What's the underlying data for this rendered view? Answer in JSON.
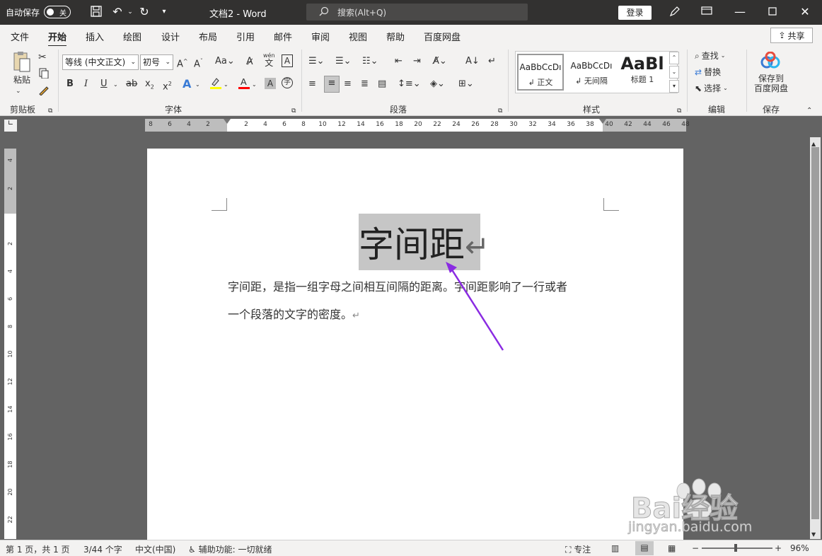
{
  "titlebar": {
    "autosave_label": "自动保存",
    "autosave_state": "关",
    "document_title": "文档2  -  Word",
    "search_placeholder": "搜索(Alt+Q)",
    "login_label": "登录"
  },
  "menu": {
    "tabs": [
      "文件",
      "开始",
      "插入",
      "绘图",
      "设计",
      "布局",
      "引用",
      "邮件",
      "审阅",
      "视图",
      "帮助",
      "百度网盘"
    ],
    "active_tab": "开始",
    "share_label": "共享"
  },
  "ribbon": {
    "clipboard": {
      "paste_label": "粘贴",
      "group_label": "剪贴板"
    },
    "font": {
      "font_name": "等线 (中文正文)",
      "font_size": "初号",
      "group_label": "字体"
    },
    "paragraph": {
      "group_label": "段落"
    },
    "styles": {
      "items": [
        {
          "preview": "AaBbCcDı",
          "name": "↲ 正文"
        },
        {
          "preview": "AaBbCcDı",
          "name": "↲ 无间隔"
        },
        {
          "preview": "AaBl",
          "name": "标题 1"
        }
      ],
      "group_label": "样式"
    },
    "editing": {
      "find_label": "查找",
      "replace_label": "替换",
      "select_label": "选择",
      "group_label": "编辑"
    },
    "save": {
      "save_to_baidu_line1": "保存到",
      "save_to_baidu_line2": "百度网盘",
      "group_label": "保存"
    }
  },
  "ruler": {
    "h_ticks": [
      "8",
      "6",
      "4",
      "2",
      "2",
      "4",
      "6",
      "8",
      "10",
      "12",
      "14",
      "16",
      "18",
      "20",
      "22",
      "24",
      "26",
      "28",
      "30",
      "32",
      "34",
      "36",
      "38",
      "40",
      "42",
      "44",
      "46",
      "48"
    ],
    "v_ticks": [
      "4",
      "2",
      "2",
      "4",
      "6",
      "8",
      "10",
      "12",
      "14",
      "16",
      "18",
      "20",
      "22"
    ]
  },
  "document": {
    "heading": "字间距",
    "heading_mark": "↵",
    "paragraph_line1": "字间距，是指一组字母之间相互间隔的距离。字间距影响了一行或者",
    "paragraph_line2": "一个段落的文字的密度。",
    "paragraph_mark": "↵"
  },
  "statusbar": {
    "page_info": "第 1 页，共 1 页",
    "word_count": "3/44 个字",
    "language": "中文(中国)",
    "accessibility": "辅助功能: 一切就绪",
    "focus_label": "专注",
    "zoom_minus": "−",
    "zoom_plus": "+",
    "zoom_level": "96%"
  },
  "watermark": {
    "brand": "Bai经验",
    "url": "jingyan.baidu.com"
  },
  "colors": {
    "titlebar_bg": "#323130",
    "ribbon_bg": "#f3f2f1",
    "selection": "#c6c6c6",
    "arrow": "#8a2be2",
    "highlight_yellow": "#ffff00",
    "font_color_red": "#ff0000"
  }
}
